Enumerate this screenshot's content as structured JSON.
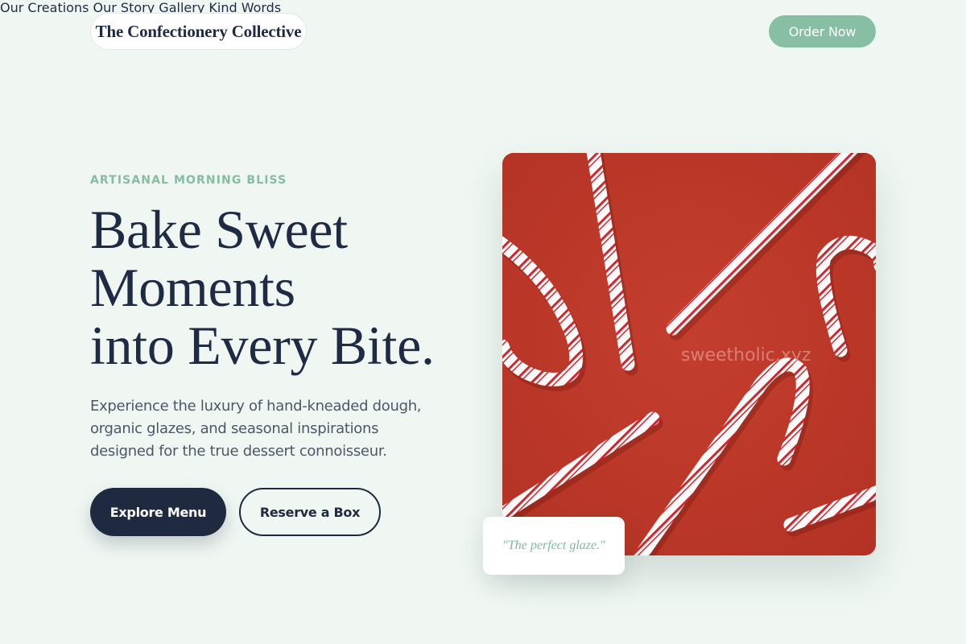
{
  "header": {
    "brand": "The Confectionery Collective",
    "nav": [
      {
        "label": "Our Creations"
      },
      {
        "label": "Our Story"
      },
      {
        "label": "Gallery"
      },
      {
        "label": "Kind Words"
      }
    ],
    "cta": "Order Now"
  },
  "hero": {
    "eyebrow": "ARTISANAL MORNING BLISS",
    "headline_lines": [
      "Bake Sweet",
      "Moments",
      "into Every Bite."
    ],
    "lede": "Experience the luxury of hand-kneaded dough, organic glazes, and seasonal inspirations designed for the true dessert connoisseur.",
    "primary_button": "Explore Menu",
    "secondary_button": "Reserve a Box",
    "image_watermark": "sweetholic.xyz",
    "quote": "\"The perfect glaze.\""
  },
  "colors": {
    "background": "#f0f7f3",
    "accent": "#86bfa3",
    "navy": "#1f2a40",
    "image_bg": "#c03a2b"
  }
}
